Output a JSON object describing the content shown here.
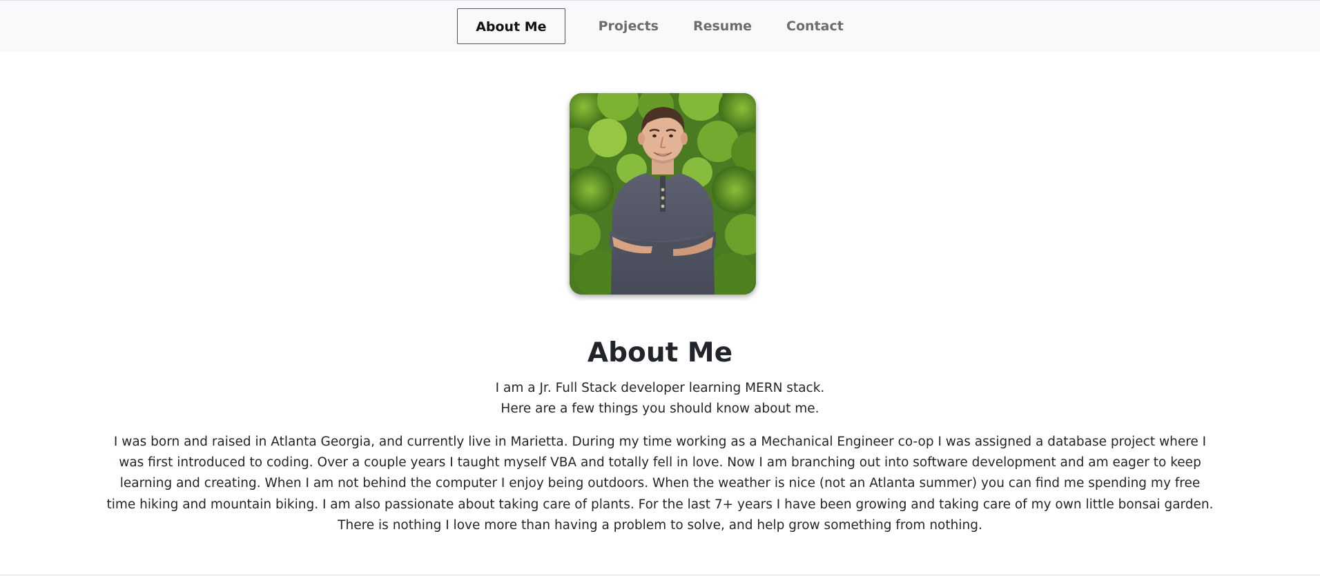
{
  "nav": {
    "items": [
      {
        "label": "About Me",
        "active": true
      },
      {
        "label": "Projects",
        "active": false
      },
      {
        "label": "Resume",
        "active": false
      },
      {
        "label": "Contact",
        "active": false
      }
    ]
  },
  "profile": {
    "photo_icon": "portrait-photo"
  },
  "about": {
    "title": "About Me",
    "intro_line1": "I am a Jr. Full Stack developer learning MERN stack.",
    "intro_line2": "Here are a few things you should know about me.",
    "bio": "I was born and raised in Atlanta Georgia, and currently live in Marietta. During my time working as a Mechanical Engineer co-op I was assigned a database project where I was first introduced to coding. Over a couple years I taught myself VBA and totally fell in love. Now I am branching out into software development and am eager to keep learning and creating. When I am not behind the computer I enjoy being outdoors. When the weather is nice (not an Atlanta summer) you can find me spending my free time hiking and mountain biking. I am also passionate about taking care of plants. For the last 7+ years I have been growing and taking care of my own little bonsai garden. There is nothing I love more than having a problem to solve, and help grow something from nothing."
  },
  "colors": {
    "navbar_bg": "#f8f9fa",
    "nav_inactive": "#6c6c6c",
    "nav_active": "#111111",
    "text": "#212529"
  }
}
